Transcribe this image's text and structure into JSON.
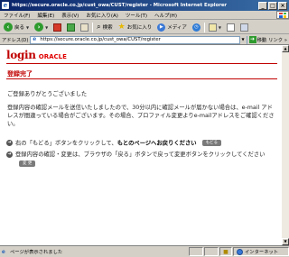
{
  "window": {
    "title": "https://secure.oracle.co.jp/cust_owa/CUST/register - Microsoft Internet Explorer",
    "controls": [
      "_",
      "□",
      "×"
    ]
  },
  "menu": [
    "ファイル(F)",
    "編集(E)",
    "表示(V)",
    "お気に入り(A)",
    "ツール(T)",
    "ヘルプ(H)"
  ],
  "toolbar": {
    "back": "戻る",
    "search": "検索",
    "favorites": "お気に入り",
    "media": "メディア"
  },
  "address": {
    "label": "アドレス(D)",
    "url": "https://secure.oracle.co.jp/cust_owa/CUST/register",
    "go": "移動",
    "links": "リンク »"
  },
  "page": {
    "logo_login": "login",
    "logo_oracle": "ORACLE",
    "heading": "登録完了",
    "thanks": "ご登録ありがとうございました",
    "paragraph": "登録内容の確認メールを送信いたしましたので、30分以内に確認メールが届かない場合は、e-mail アドレスが間違っている場合がございます。その場合、プロファイル変更よりe-mailアドレスをご確認ください。",
    "line1_prefix": "右の「もどる」ボタンをクリックして、",
    "line1_bold": "もとのページへお戻りください",
    "back_button": "もどる",
    "line2": "登録内容の確認・変更は、ブラウザの「戻る」ボタンで戻って変更ボタンをクリックしてください",
    "change_button": "変 更"
  },
  "status": {
    "text": "ページが表示されました",
    "zone": "インターネット"
  }
}
